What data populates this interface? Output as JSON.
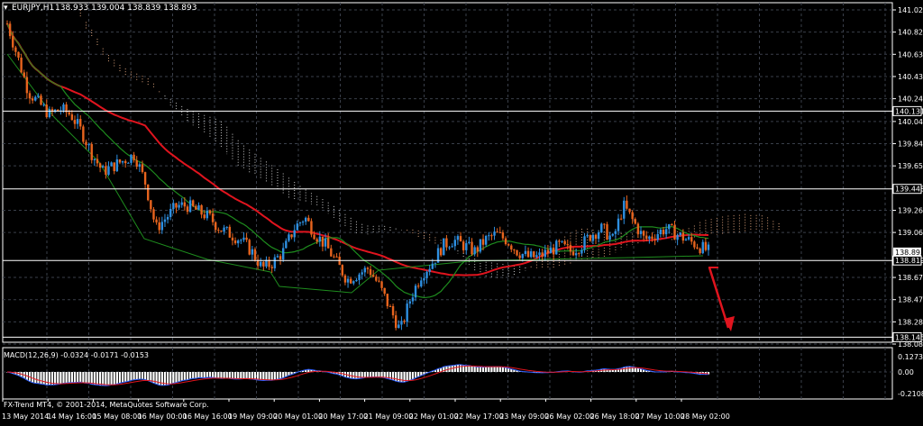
{
  "window": {
    "symbol_label": "EURJPY,H1",
    "ohlc": "138.933 139.004 138.839 138.893"
  },
  "price_axis": {
    "labels": [
      "141.020",
      "140.825",
      "140.630",
      "140.435",
      "140.240",
      "140.040",
      "139.845",
      "139.650",
      "139.260",
      "139.065",
      "138.670",
      "138.475",
      "138.280",
      "138.085"
    ],
    "values": [
      141.02,
      140.825,
      140.63,
      140.435,
      140.24,
      140.04,
      139.845,
      139.65,
      139.26,
      139.065,
      138.67,
      138.475,
      138.28,
      138.085
    ],
    "ylim": [
      138.085,
      141.02
    ]
  },
  "level_lines": [
    {
      "label": "140.131",
      "value": 140.131
    },
    {
      "label": "139.448",
      "value": 139.448
    },
    {
      "label": "138.819",
      "value": 138.819
    },
    {
      "label": "138.145",
      "value": 138.145
    }
  ],
  "current_price": {
    "label": "138.893",
    "value": 138.893
  },
  "macd": {
    "header": "MACD(12,26,9) -0.0324 -0.0171 -0.0153",
    "axis_labels": [
      "0.1273",
      "0.00",
      "-0.2108"
    ],
    "axis_values": [
      0.1273,
      0.0,
      -0.2108
    ]
  },
  "copyright": "FX-Trend MT4, © 2001-2014, MetaQuotes Software Corp.",
  "time_axis": [
    "13 May 2014",
    "14 May 16:00",
    "15 May 08:00",
    "16 May 00:00",
    "16 May 16:00",
    "19 May 09:00",
    "20 May 01:00",
    "20 May 17:00",
    "21 May 09:00",
    "22 May 01:00",
    "22 May 17:00",
    "23 May 09:00",
    "26 May 02:00",
    "26 May 18:00",
    "27 May 10:00",
    "28 May 02:00"
  ],
  "colors": {
    "background": "#000000",
    "grid": "#3a3f4a",
    "bull_candle": "#2e8fe0",
    "bear_candle": "#e8641e",
    "ma_red": "#e0141e",
    "ma_green": "#1e8c1e",
    "ichimoku_cloud_bear": "#c8c8c8",
    "ichimoku_cloud_bull": "#d9a07a",
    "level_line": "#ffffff",
    "arrow": "#e0141e",
    "macd_histogram": "#ffffff",
    "macd_line": "#3060ff",
    "signal_line": "#e0141e"
  },
  "chart_data": {
    "type": "candlestick",
    "price_path": [
      140.9,
      140.6,
      140.3,
      140.2,
      140.1,
      140.15,
      140.1,
      139.95,
      139.75,
      139.6,
      139.65,
      139.7,
      139.75,
      139.5,
      139.1,
      139.2,
      139.3,
      139.3,
      139.25,
      139.2,
      139.1,
      139.05,
      139.0,
      138.9,
      138.75,
      138.8,
      138.9,
      139.1,
      139.2,
      139.05,
      138.95,
      138.8,
      138.65,
      138.7,
      138.75,
      138.6,
      138.4,
      138.2,
      138.5,
      138.7,
      138.8,
      138.95,
      139.0,
      138.95,
      138.9,
      139.0,
      139.05,
      139.0,
      138.9,
      138.85,
      138.85,
      138.9,
      138.95,
      138.9,
      138.95,
      139.05,
      139.1,
      139.0,
      139.3,
      139.15,
      139.0,
      139.05,
      139.1,
      139.05,
      139.0,
      138.95,
      138.9
    ]
  }
}
